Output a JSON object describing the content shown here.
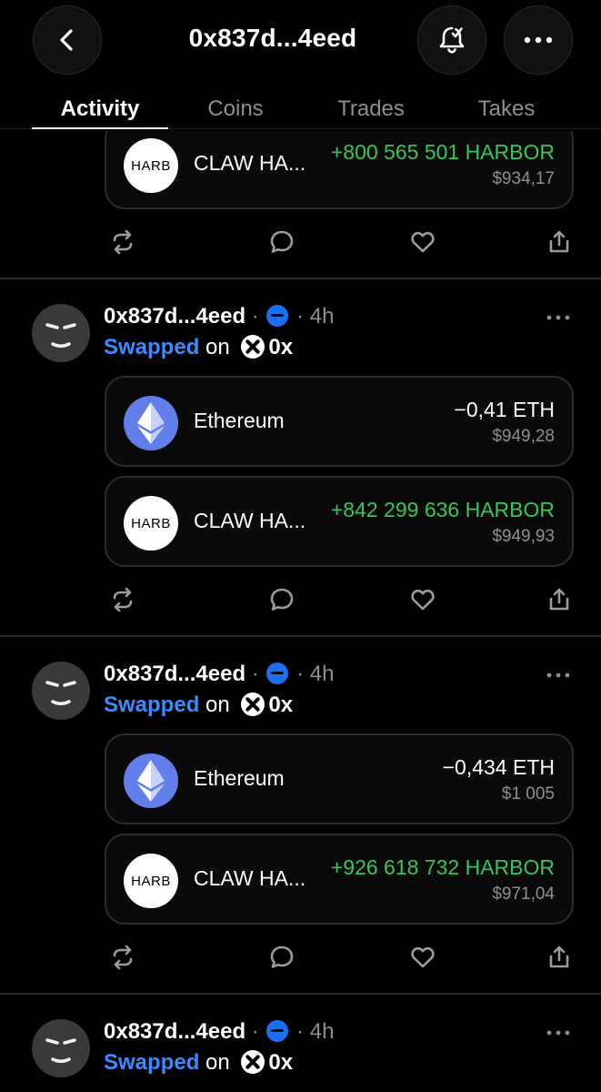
{
  "header": {
    "back_icon": "chevron-left-icon",
    "title": "0x837d...4eed",
    "bell_icon": "bell-check-icon",
    "more_icon": "ellipsis-icon"
  },
  "tabs": [
    {
      "label": "Activity",
      "active": true
    },
    {
      "label": "Coins",
      "active": false
    },
    {
      "label": "Trades",
      "active": false
    },
    {
      "label": "Takes",
      "active": false
    }
  ],
  "posts": [
    {
      "partial": true,
      "cards": [
        {
          "logo": "HARB",
          "name": "CLAW HA...",
          "amount": "+800 565 501 HARBOR",
          "usd": "$934,17",
          "direction": "in"
        }
      ]
    },
    {
      "author": "0x837d...4eed",
      "separator": "·",
      "time": "4h",
      "action": "Swapped",
      "on": "on",
      "exchange": "0x",
      "cards": [
        {
          "logo": "eth",
          "name": "Ethereum",
          "amount": "−0,41 ETH",
          "usd": "$949,28",
          "direction": "out"
        },
        {
          "logo": "HARB",
          "name": "CLAW HA...",
          "amount": "+842 299 636 HARBOR",
          "usd": "$949,93",
          "direction": "in"
        }
      ]
    },
    {
      "author": "0x837d...4eed",
      "separator": "·",
      "time": "4h",
      "action": "Swapped",
      "on": "on",
      "exchange": "0x",
      "cards": [
        {
          "logo": "eth",
          "name": "Ethereum",
          "amount": "−0,434 ETH",
          "usd": "$1 005",
          "direction": "out"
        },
        {
          "logo": "HARB",
          "name": "CLAW HA...",
          "amount": "+926 618 732 HARBOR",
          "usd": "$971,04",
          "direction": "in"
        }
      ]
    },
    {
      "author": "0x837d...4eed",
      "separator": "·",
      "time": "4h",
      "action": "Swapped",
      "on": "on",
      "exchange": "0x"
    }
  ],
  "post_actions": [
    "repost-icon",
    "comment-icon",
    "like-icon",
    "share-icon"
  ],
  "colors": {
    "background": "#000000",
    "card_border": "#2c2c2e",
    "positive": "#34c759",
    "link": "#3b8bff",
    "muted": "#8e8e93",
    "verified": "#1d6ff2",
    "eth": "#627eea"
  }
}
